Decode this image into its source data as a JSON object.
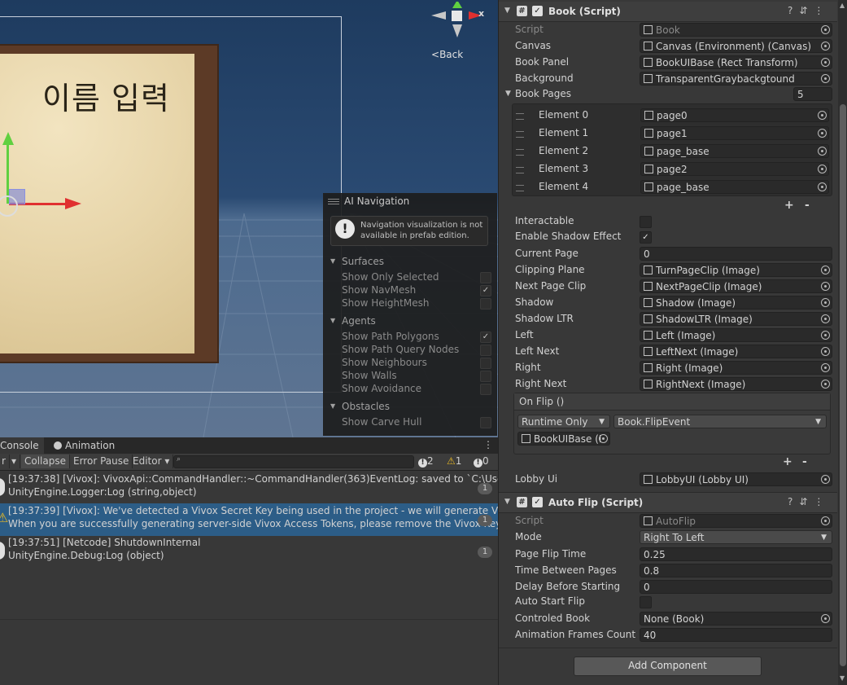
{
  "scene": {
    "page_title": "이름 입력",
    "back_label": "Back",
    "gizmo_x_label": "x"
  },
  "ai_navigation": {
    "title": "AI Navigation",
    "info": "Navigation visualization is not available in prefab edition.",
    "sections": [
      {
        "name": "Surfaces",
        "items": [
          {
            "label": "Show Only Selected",
            "checked": false
          },
          {
            "label": "Show NavMesh",
            "checked": true
          },
          {
            "label": "Show HeightMesh",
            "checked": false
          }
        ]
      },
      {
        "name": "Agents",
        "items": [
          {
            "label": "Show Path Polygons",
            "checked": true
          },
          {
            "label": "Show Path Query Nodes",
            "checked": false
          },
          {
            "label": "Show Neighbours",
            "checked": false
          },
          {
            "label": "Show Walls",
            "checked": false
          },
          {
            "label": "Show Avoidance",
            "checked": false
          }
        ]
      },
      {
        "name": "Obstacles",
        "items": [
          {
            "label": "Show Carve Hull",
            "checked": false
          }
        ]
      }
    ]
  },
  "console": {
    "tabs": [
      "Console",
      "Animation"
    ],
    "toolbar": {
      "clear_partial": "r",
      "collapse": "Collapse",
      "error_pause": "Error Pause",
      "editor": "Editor",
      "search_placeholder": "",
      "info_count": "2",
      "warn_count": "1",
      "error_count": "0"
    },
    "logs": [
      {
        "line1": "[19:37:38] [Vivox]: VivoxApi::CommandHandler::~CommandHandler(363)EventLog: saved to `C:\\Users\\tigh",
        "line2": "UnityEngine.Logger:Log (string,object)",
        "count": "1",
        "type": "info",
        "selected": false
      },
      {
        "line1": "[19:37:39] [Vivox]: We've detected a Vivox Secret Key being used in the project - we will generate Vivox Acce",
        "line2": "When you are successfully generating server-side Vivox Access Tokens, please remove the Vivox Key from",
        "count": "1",
        "type": "warning",
        "selected": true
      },
      {
        "line1": "[19:37:51] [Netcode] ShutdownInternal",
        "line2": "UnityEngine.Debug:Log (object)",
        "count": "1",
        "type": "info",
        "selected": false
      }
    ]
  },
  "inspector": {
    "book": {
      "title": "Book (Script)",
      "script_label": "Script",
      "script_value": "Book",
      "canvas_label": "Canvas",
      "canvas_value": "Canvas (Environment) (Canvas)",
      "book_panel_label": "Book Panel",
      "book_panel_value": "BookUIBase (Rect Transform)",
      "background_label": "Background",
      "background_value": "TransparentGraybackgtound",
      "book_pages_label": "Book Pages",
      "book_pages_count": "5",
      "elements": [
        {
          "label": "Element 0",
          "value": "page0"
        },
        {
          "label": "Element 1",
          "value": "page1"
        },
        {
          "label": "Element 2",
          "value": "page_base"
        },
        {
          "label": "Element 3",
          "value": "page2"
        },
        {
          "label": "Element 4",
          "value": "page_base"
        }
      ],
      "interactable_label": "Interactable",
      "interactable": false,
      "shadow_effect_label": "Enable Shadow Effect",
      "shadow_effect": true,
      "current_page_label": "Current Page",
      "current_page": "0",
      "refs": [
        {
          "label": "Clipping Plane",
          "value": "TurnPageClip (Image)"
        },
        {
          "label": "Next Page Clip",
          "value": "NextPageClip (Image)"
        },
        {
          "label": "Shadow",
          "value": "Shadow (Image)"
        },
        {
          "label": "Shadow LTR",
          "value": "ShadowLTR (Image)"
        },
        {
          "label": "Left",
          "value": "Left (Image)"
        },
        {
          "label": "Left Next",
          "value": "LeftNext (Image)"
        },
        {
          "label": "Right",
          "value": "Right (Image)"
        },
        {
          "label": "Right Next",
          "value": "RightNext (Image)"
        }
      ],
      "on_flip_label": "On Flip ()",
      "runtime": "Runtime Only",
      "function": "Book.FlipEvent",
      "target": "BookUIBase (I",
      "lobby_ui_label": "Lobby Ui",
      "lobby_ui_value": "LobbyUI (Lobby UI)"
    },
    "autoflip": {
      "title": "Auto Flip (Script)",
      "script_label": "Script",
      "script_value": "AutoFlip",
      "mode_label": "Mode",
      "mode_value": "Right To Left",
      "flip_time_label": "Page Flip Time",
      "flip_time": "0.25",
      "between_label": "Time Between Pages",
      "between": "0.8",
      "delay_label": "Delay Before Starting",
      "delay": "0",
      "auto_start_label": "Auto Start Flip",
      "auto_start": false,
      "controled_label": "Controled Book",
      "controled_value": "None (Book)",
      "frames_label": "Animation Frames Count",
      "frames": "40"
    },
    "add_component": "Add Component"
  }
}
